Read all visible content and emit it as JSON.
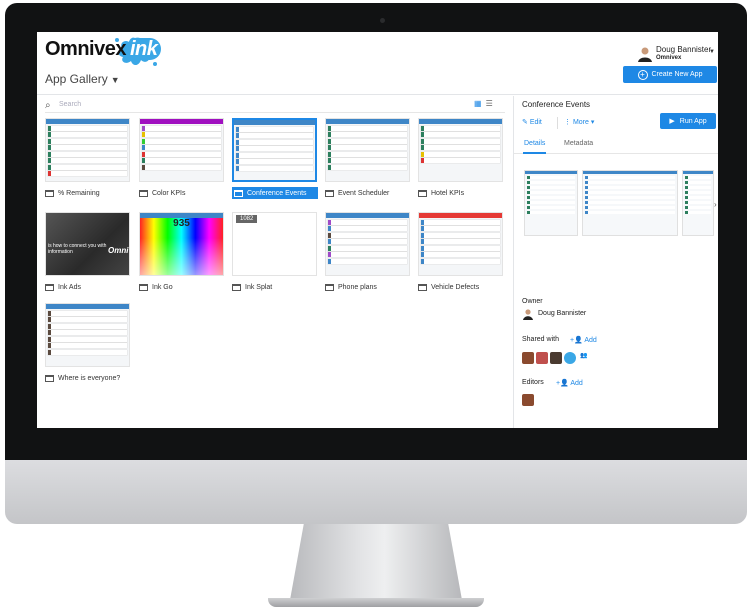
{
  "header": {
    "logo_text": "Omnivex",
    "logo_ink": "ink",
    "app_title": "App Gallery",
    "user_name": "Doug Bannister",
    "user_org": "Omnivex",
    "create_label": "Create New App"
  },
  "search": {
    "placeholder": "Search"
  },
  "apps": [
    {
      "name": "% Remaining"
    },
    {
      "name": "Color KPIs"
    },
    {
      "name": "Conference Events"
    },
    {
      "name": "Event Scheduler"
    },
    {
      "name": "Hotel KPIs"
    },
    {
      "name": "Ink Ads"
    },
    {
      "name": "Ink Go"
    },
    {
      "name": "Ink Splat"
    },
    {
      "name": "Phone plans"
    },
    {
      "name": "Vehicle Defects"
    },
    {
      "name": "Where is everyone?"
    }
  ],
  "thumb_text": {
    "ink_go_value": "935",
    "ink_splat_value": "1082",
    "ink_ads_caption": "is how to connect you with information",
    "ink_ads_logo": "Omni"
  },
  "panel": {
    "title": "Conference Events",
    "edit_label": "Edit",
    "more_label": "More",
    "run_label": "Run App",
    "tabs": [
      "Details",
      "Metadata"
    ],
    "owner_label": "Owner",
    "owner_name": "Doug Bannister",
    "shared_label": "Shared with",
    "add_label": "Add",
    "editors_label": "Editors"
  },
  "colors": {
    "accent": "#1e88e5"
  }
}
